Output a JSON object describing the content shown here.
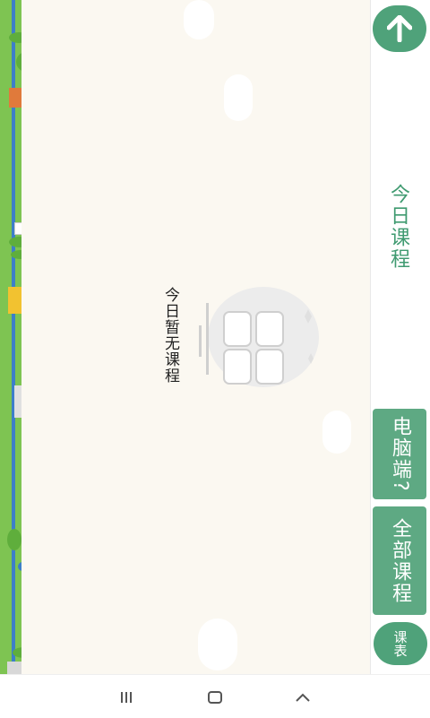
{
  "main": {
    "empty_message": "今日暂无课程"
  },
  "side": {
    "today_tab_label": "今日课程",
    "pc_button_label": "电脑端?",
    "all_courses_label": "全部课程",
    "schedule_label": "课表"
  },
  "icons": {
    "scroll_up": "arrow-up-icon",
    "recent_apps": "recent-apps-icon",
    "home": "home-icon",
    "back": "back-icon"
  },
  "colors": {
    "accent": "#4fa27a",
    "button_bg": "#5ea983",
    "tab_text": "#3f9a70",
    "background": "#fbf8f1"
  }
}
